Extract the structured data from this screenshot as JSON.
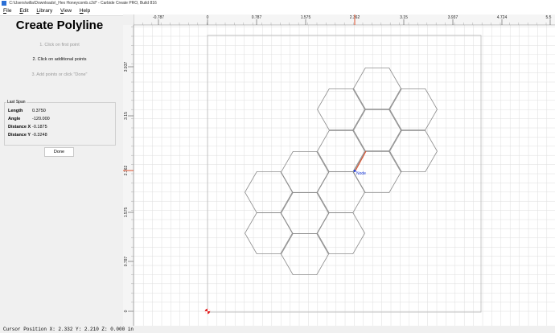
{
  "window": {
    "title": "C:\\Users\\willa\\Downloads\\_Hex Honeycomb.c2d* - Carbide Create PRO, Build 816"
  },
  "menu": {
    "items": [
      "File",
      "Edit",
      "Library",
      "View",
      "Help"
    ]
  },
  "panel": {
    "title": "Create Polyline",
    "steps": [
      "1. Click on first point",
      "2. Click on additional points",
      "3. Add points or click \"Done\""
    ],
    "last_span_label": "Last Span",
    "fields": [
      {
        "label": "Length",
        "value": "0.3750"
      },
      {
        "label": "Angle",
        "value": "-120.000"
      },
      {
        "label": "Distance X",
        "value": "-0.1875"
      },
      {
        "label": "Distance Y",
        "value": "-0.3248"
      }
    ],
    "done_label": "Done"
  },
  "ruler": {
    "x_ticks": [
      "-0.787",
      "0",
      "0.787",
      "1.575",
      "2.362",
      "3.15",
      "3.937",
      "4.724",
      "5.5"
    ],
    "y_ticks": [
      "3.937",
      "3.15",
      "2.362",
      "1.575",
      "0.787",
      "0"
    ]
  },
  "canvas": {
    "node_label": "Node",
    "colors": {
      "polyline": "#e0502a",
      "node": "#1a3ad8",
      "grid": "#dedede",
      "hex": "#8c8c8c"
    }
  },
  "status": {
    "text": "Cursor Position X: 2.332 Y: 2.210 Z: 0.000 in"
  }
}
